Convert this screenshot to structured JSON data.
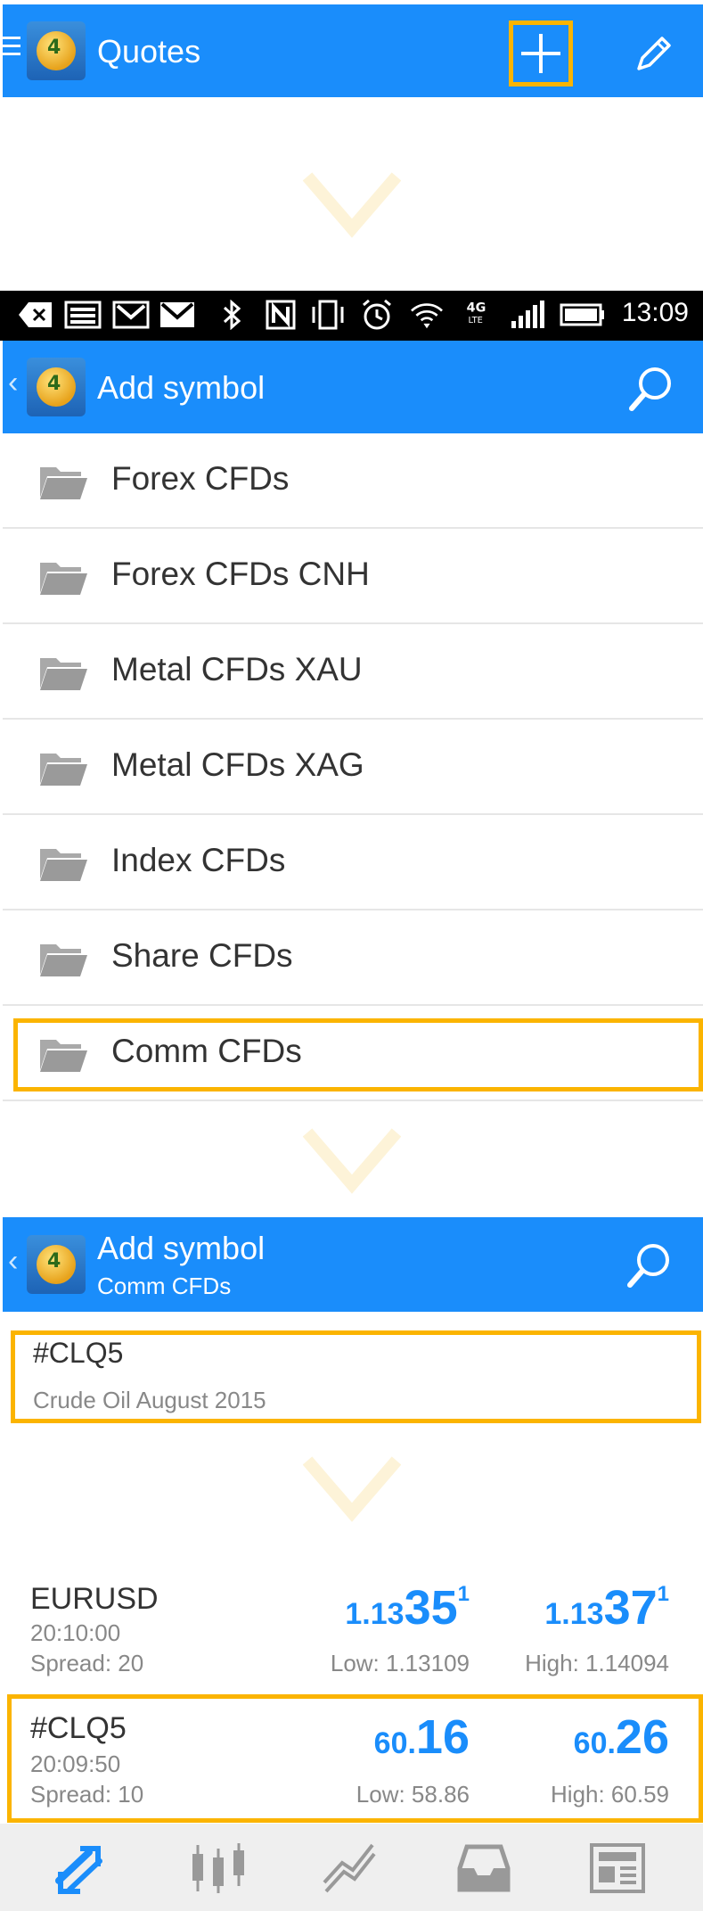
{
  "quotes_bar": {
    "title": "Quotes",
    "icons": [
      "menu-icon",
      "app-logo",
      "add-icon",
      "edit-icon"
    ]
  },
  "status_bar": {
    "time": "13:09",
    "icons": [
      "back-icon",
      "image-icon",
      "gmail-icon",
      "mail-icon",
      "bluetooth-icon",
      "nfc-icon",
      "vibrate-icon",
      "alarm-icon",
      "wifi-icon",
      "4g-lte-icon",
      "signal-icon",
      "battery-icon"
    ]
  },
  "add_symbol": {
    "title": "Add symbol",
    "folders": [
      {
        "label": "Forex CFDs"
      },
      {
        "label": "Forex CFDs CNH"
      },
      {
        "label": "Metal CFDs XAU"
      },
      {
        "label": "Metal CFDs XAG"
      },
      {
        "label": "Index CFDs"
      },
      {
        "label": "Share CFDs"
      },
      {
        "label": "Comm CFDs"
      }
    ]
  },
  "comm_cfds": {
    "title": "Add symbol",
    "subtitle": "Comm CFDs",
    "symbol": {
      "name": "#CLQ5",
      "description": "Crude Oil August 2015"
    }
  },
  "quotes": [
    {
      "name": "EURUSD",
      "time": "20:10:00",
      "spread": "Spread: 20",
      "bid": {
        "pre": "1.13",
        "big": "35",
        "sup": "1"
      },
      "ask": {
        "pre": "1.13",
        "big": "37",
        "sup": "1"
      },
      "low": "Low: 1.13109",
      "high": "High: 1.14094"
    },
    {
      "name": "#CLQ5",
      "time": "20:09:50",
      "spread": "Spread: 10",
      "bid": {
        "pre": "60.",
        "big": "16",
        "sup": ""
      },
      "ask": {
        "pre": "60.",
        "big": "26",
        "sup": ""
      },
      "low": "Low: 58.86",
      "high": "High: 60.59"
    }
  ],
  "bottom_nav": [
    "quotes-icon",
    "chart-icon",
    "trade-icon",
    "history-icon",
    "news-icon"
  ],
  "colors": {
    "accent": "#1a8dfb",
    "highlight": "#fbb400"
  }
}
